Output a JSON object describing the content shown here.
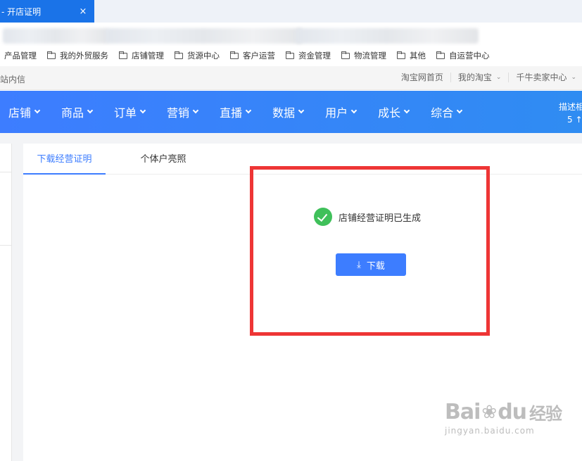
{
  "browser": {
    "tab_title": "- 开店证明",
    "tab_close": "×"
  },
  "bookmarks": [
    "产品管理",
    "我的外贸服务",
    "店铺管理",
    "货源中心",
    "客户运营",
    "资金管理",
    "物流管理",
    "其他",
    "自运营中心"
  ],
  "sitebar": {
    "left_text": "站内信",
    "links": [
      {
        "label": "淘宝网首页",
        "dropdown": false
      },
      {
        "label": "我的淘宝",
        "dropdown": true
      },
      {
        "label": "千牛卖家中心",
        "dropdown": true
      }
    ],
    "caret": "⌄"
  },
  "nav": {
    "items": [
      "店铺",
      "商品",
      "订单",
      "营销",
      "直播",
      "数据",
      "用户",
      "成长",
      "综合"
    ],
    "right_label": "描述相",
    "right_value": "5 ↑"
  },
  "tabs": {
    "active": "下载经营证明",
    "inactive": "个体户亮照"
  },
  "status": {
    "message": "店铺经营证明已生成"
  },
  "download": {
    "label": "下载",
    "icon": "⤓"
  },
  "watermark": {
    "brand_left": "Bai",
    "brand_right": "du",
    "brand_cn": "经验",
    "url": "jingyan.baidu.com"
  },
  "colors": {
    "accent": "#3d7dff",
    "success": "#3fc05a",
    "highlight": "#ee3535",
    "tab_active_bg": "#1a73e8"
  }
}
